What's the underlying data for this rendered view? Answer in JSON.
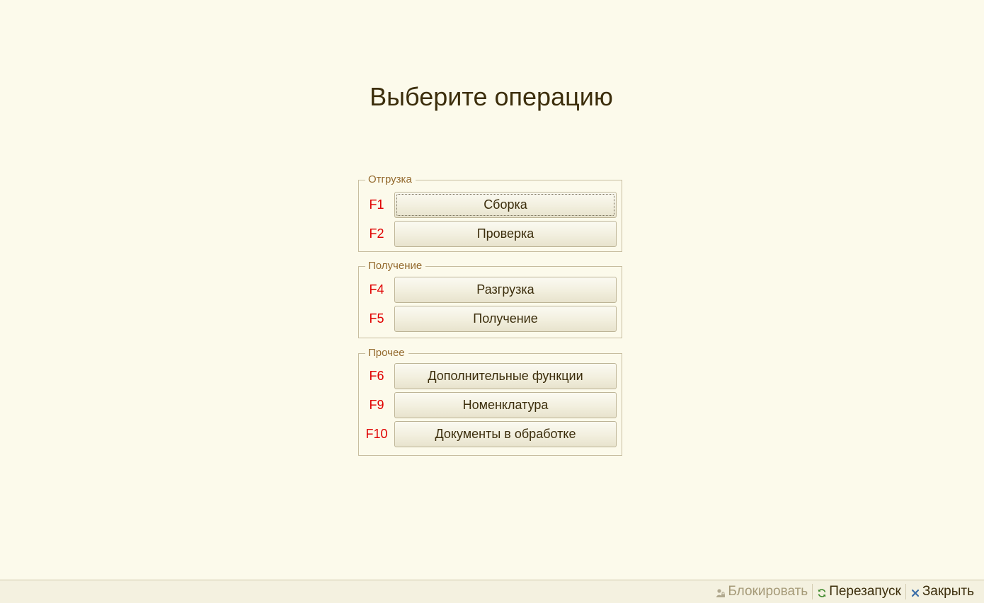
{
  "title": "Выберите операцию",
  "groups": [
    {
      "legend": "Отгрузка",
      "items": [
        {
          "key": "F1",
          "label": "Сборка"
        },
        {
          "key": "F2",
          "label": "Проверка"
        }
      ]
    },
    {
      "legend": "Получение",
      "items": [
        {
          "key": "F4",
          "label": "Разгрузка"
        },
        {
          "key": "F5",
          "label": "Получение"
        }
      ]
    },
    {
      "legend": "Прочее",
      "items": [
        {
          "key": "F6",
          "label": "Дополнительные функции"
        },
        {
          "key": "F9",
          "label": "Номенклатура"
        },
        {
          "key": "F10",
          "label": "Документы в обработке"
        }
      ]
    }
  ],
  "statusbar": {
    "lock": {
      "label": "Блокировать",
      "icon": "lock-user-icon"
    },
    "restart": {
      "label": "Перезапуск",
      "icon": "refresh-icon"
    },
    "close": {
      "label": "Закрыть",
      "icon": "close-icon"
    }
  },
  "colors": {
    "background": "#fcfaeb",
    "title": "#3c2e0c",
    "legend": "#946a2e",
    "fkey": "#e00000",
    "border": "#c7bd9f"
  }
}
